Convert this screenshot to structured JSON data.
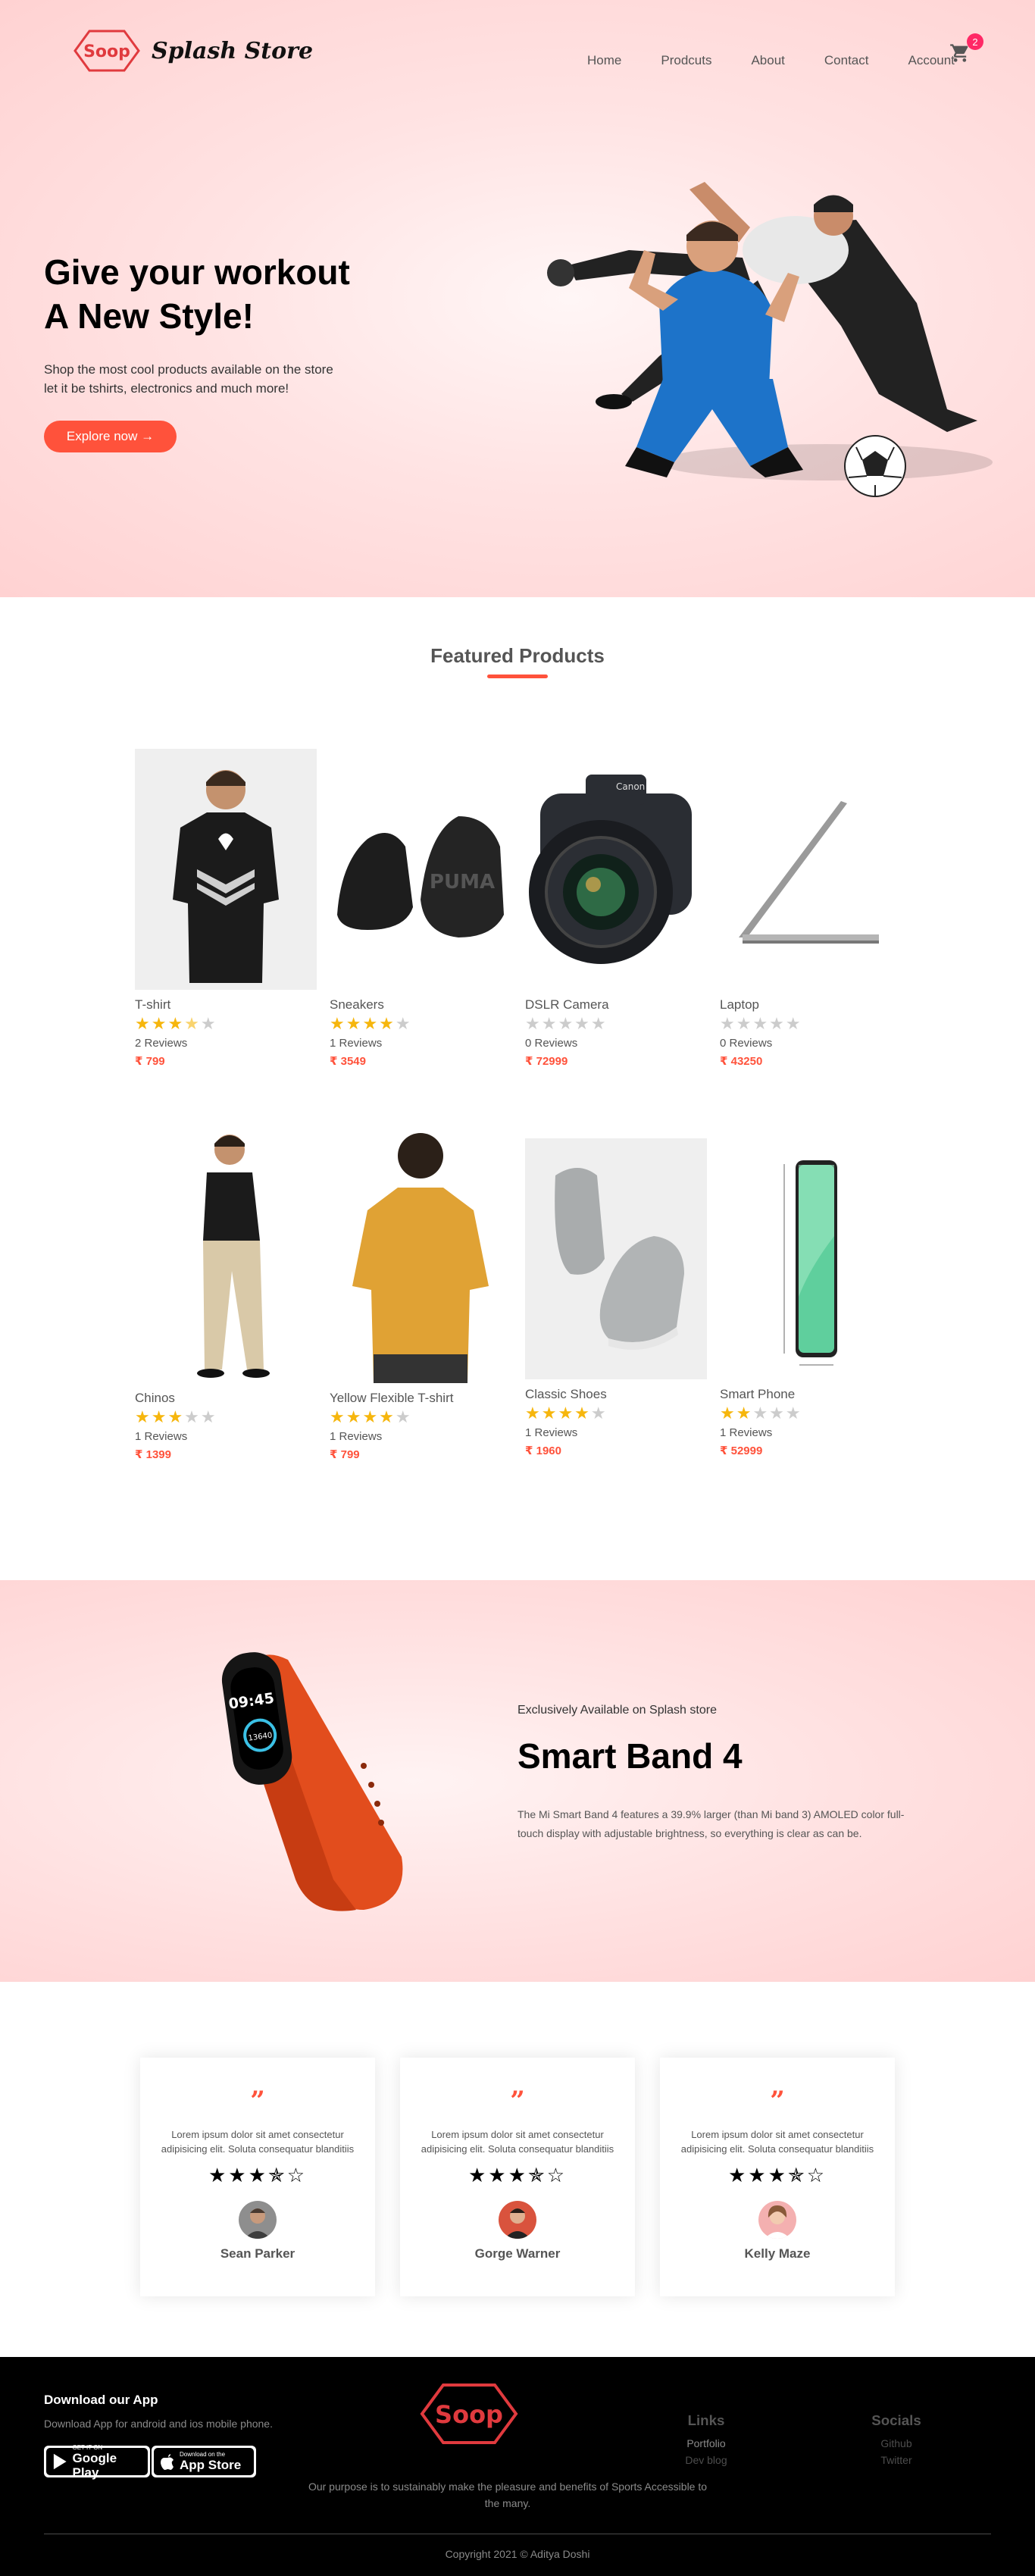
{
  "brand": {
    "logo_text": "Soop",
    "name": "Splash Store"
  },
  "nav": {
    "items": [
      "Home",
      "Prodcuts",
      "About",
      "Contact",
      "Account"
    ],
    "cart_count": "2"
  },
  "hero": {
    "title_line1": "Give your workout",
    "title_line2": "A New Style!",
    "desc_line1": "Shop the most cool products available on the store",
    "desc_line2": "let it be tshirts, electronics and much more!",
    "cta": "Explore now →"
  },
  "featured": {
    "title": "Featured Products",
    "products": [
      {
        "name": "T-shirt",
        "rating": 3.5,
        "reviews": "2 Reviews",
        "price": "₹ 799"
      },
      {
        "name": "Sneakers",
        "rating": 4,
        "reviews": "1 Reviews",
        "price": "₹ 3549"
      },
      {
        "name": "DSLR Camera",
        "rating": 0,
        "reviews": "0 Reviews",
        "price": "₹ 72999"
      },
      {
        "name": "Laptop",
        "rating": 0,
        "reviews": "0 Reviews",
        "price": "₹ 43250"
      },
      {
        "name": "Chinos",
        "rating": 3,
        "reviews": "1 Reviews",
        "price": "₹ 1399"
      },
      {
        "name": "Yellow Flexible T-shirt",
        "rating": 4,
        "reviews": "1 Reviews",
        "price": "₹ 799"
      },
      {
        "name": "Classic Shoes",
        "rating": 4,
        "reviews": "1 Reviews",
        "price": "₹ 1960"
      },
      {
        "name": "Smart Phone",
        "rating": 2,
        "reviews": "1 Reviews",
        "price": "₹ 52999"
      }
    ]
  },
  "offer": {
    "small": "Exclusively Available on Splash store",
    "title": "Smart Band 4",
    "desc": "The Mi Smart Band 4 features a 39.9% larger (than Mi band 3) AMOLED color full-touch display with adjustable brightness, so everything is clear as can be.",
    "watch_time": "09:45",
    "watch_steps": "13640"
  },
  "testimonials": [
    {
      "text": "Lorem ipsum dolor sit amet consectetur adipisicing elit. Soluta consequatur blanditiis",
      "stars": "★★★✯☆",
      "name": "Sean Parker"
    },
    {
      "text": "Lorem ipsum dolor sit amet consectetur adipisicing elit. Soluta consequatur blanditiis",
      "stars": "★★★✯☆",
      "name": "Gorge Warner"
    },
    {
      "text": "Lorem ipsum dolor sit amet consectetur adipisicing elit. Soluta consequatur blanditiis",
      "stars": "★★★✯☆",
      "name": "Kelly Maze"
    }
  ],
  "footer": {
    "app_title": "Download our App",
    "app_desc": "Download App for android and ios mobile phone.",
    "google_small": "GET IT ON",
    "google_big": "Google Play",
    "apple_small": "Download on the",
    "apple_big": "App Store",
    "purpose": "Our purpose is to sustainably make the pleasure and benefits of Sports Accessible to the many.",
    "links_title": "Links",
    "links": [
      "Portfolio",
      "Dev blog"
    ],
    "socials_title": "Socials",
    "socials": [
      "Github",
      "Twitter"
    ],
    "copyright": "Copyright 2021 © Aditya Doshi"
  },
  "colors": {
    "accent": "#ff523b",
    "star": "#f6b60d",
    "badge": "#ff2966"
  }
}
